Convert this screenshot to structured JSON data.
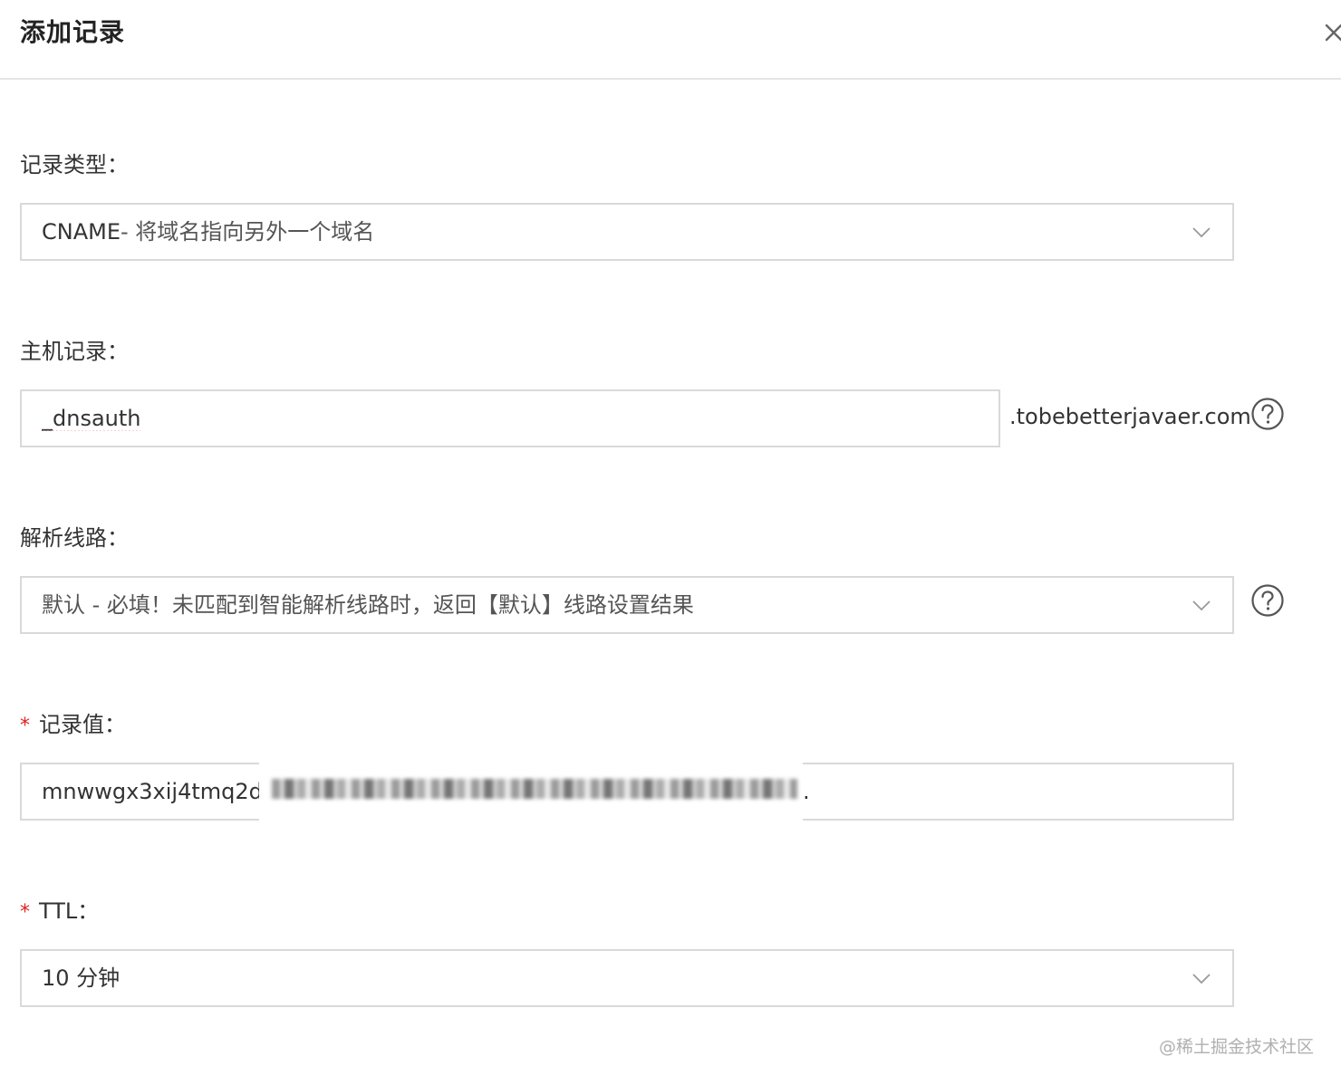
{
  "dialog": {
    "title": "添加记录",
    "close_icon": "close-icon"
  },
  "record_type": {
    "label": "记录类型：",
    "value": "CNAME",
    "description": "- 将域名指向另外一个域名"
  },
  "host_record": {
    "label": "主机记录：",
    "value": "_dnsauth",
    "suffix": ".tobebetterjavaer.com",
    "help_icon": "question-circle-icon"
  },
  "resolution_line": {
    "label": "解析线路：",
    "value": "默认 - 必填！未匹配到智能解析线路时，返回【默认】线路设置结果",
    "help_icon": "question-circle-icon"
  },
  "record_value": {
    "required_mark": "*",
    "label": "记录值：",
    "value_visible": "mnwwgx3xij4tmq2dn",
    "value_end": "."
  },
  "ttl": {
    "required_mark": "*",
    "label": "TTL：",
    "value": "10 分钟"
  },
  "watermark": "@稀土掘金技术社区"
}
